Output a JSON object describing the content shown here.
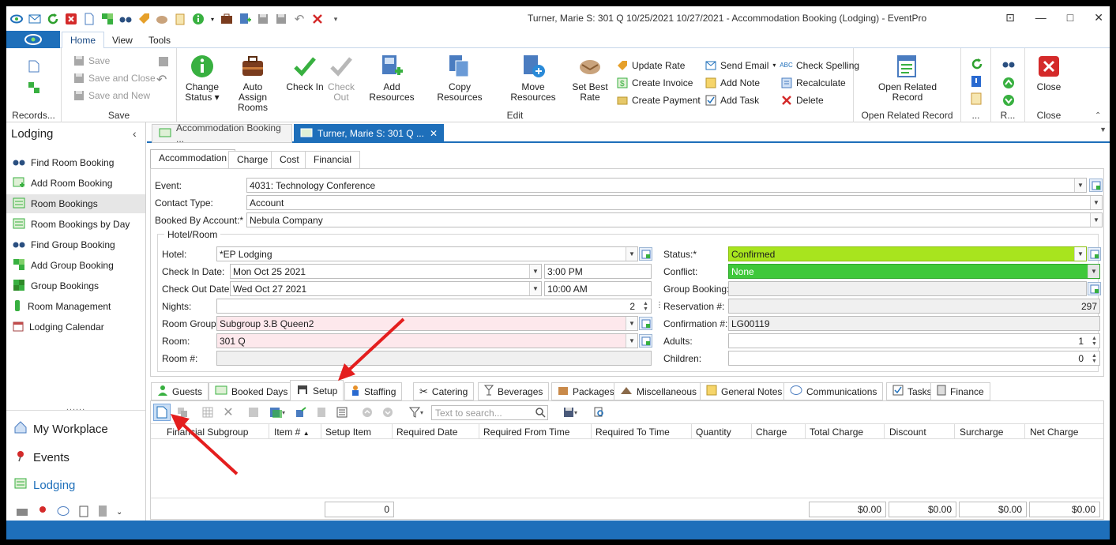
{
  "window": {
    "title": "Turner, Marie S: 301 Q 10/25/2021 10/27/2021 - Accommodation Booking (Lodging) - EventPro"
  },
  "ribbon_tabs": [
    "Home",
    "View",
    "Tools"
  ],
  "ribbon": {
    "records_label": "Records...",
    "save_group": {
      "label": "Save",
      "save": "Save",
      "save_close": "Save and Close",
      "save_new": "Save and New"
    },
    "edit_group": {
      "label": "Edit",
      "change_status": "Change Status",
      "auto_assign": "Auto Assign Rooms",
      "check_in": "Check In",
      "check_out": "Check Out",
      "add_resources": "Add Resources",
      "copy_resources": "Copy Resources",
      "move_resources": "Move Resources",
      "set_best_rate": "Set Best Rate",
      "update_rate": "Update Rate",
      "create_invoice": "Create Invoice",
      "create_payment": "Create Payment",
      "send_email": "Send Email",
      "add_note": "Add Note",
      "add_task": "Add Task",
      "check_spelling": "Check Spelling",
      "recalculate": "Recalculate",
      "delete": "Delete"
    },
    "open_related": {
      "label": "Open Related Record",
      "button": "Open Related Record"
    },
    "dots_label": "...",
    "r_label": "R...",
    "close_group": {
      "label": "Close",
      "button": "Close"
    }
  },
  "nav": {
    "header": "Lodging",
    "items": [
      {
        "label": "Find Room Booking",
        "icon": "binoculars-icon"
      },
      {
        "label": "Add Room Booking",
        "icon": "add-booking-icon"
      },
      {
        "label": "Room Bookings",
        "icon": "room-bookings-icon"
      },
      {
        "label": "Room Bookings by Day",
        "icon": "room-bookings-day-icon"
      },
      {
        "label": "Find Group Booking",
        "icon": "binoculars-icon"
      },
      {
        "label": "Add Group Booking",
        "icon": "add-group-icon"
      },
      {
        "label": "Group Bookings",
        "icon": "group-bookings-icon"
      },
      {
        "label": "Room Management",
        "icon": "room-management-icon"
      },
      {
        "label": "Lodging Calendar",
        "icon": "calendar-icon"
      }
    ],
    "grip": "......",
    "bottom": [
      {
        "label": "My Workplace",
        "icon": "home-icon"
      },
      {
        "label": "Events",
        "icon": "pin-icon"
      },
      {
        "label": "Lodging",
        "icon": "lodging-icon"
      }
    ]
  },
  "doc_tabs": [
    {
      "label": "Accommodation Booking ..."
    },
    {
      "label": "Turner, Marie S: 301 Q ..."
    }
  ],
  "form_tabs": [
    "Accommodation",
    "Charge",
    "Cost",
    "Financial"
  ],
  "form": {
    "event_label": "Event:",
    "event": "4031: Technology Conference",
    "contact_type_label": "Contact Type:",
    "contact_type": "Account",
    "booked_by_label": "Booked By Account:*",
    "booked_by": "Nebula Company",
    "hotel_room_legend": "Hotel/Room",
    "hotel_label": "Hotel:",
    "hotel": "*EP Lodging",
    "check_in_label": "Check In Date:",
    "check_in_date": "Mon Oct 25 2021",
    "check_in_time": "3:00 PM",
    "check_out_label": "Check Out Date:",
    "check_out_date": "Wed Oct 27 2021",
    "check_out_time": "10:00 AM",
    "nights_label": "Nights:",
    "nights": "2",
    "room_group_label": "Room Group:",
    "room_group": "Subgroup 3.B Queen2",
    "room_label": "Room:",
    "room": "301 Q",
    "room_num_label": "Room #:",
    "room_num": "",
    "status_label": "Status:*",
    "status": "Confirmed",
    "conflict_label": "Conflict:",
    "conflict": "None",
    "group_booking_label": "Group Booking:",
    "group_booking": "",
    "reservation_label": "Reservation #:",
    "reservation": "297",
    "confirmation_label": "Confirmation #:",
    "confirmation": "LG00119",
    "adults_label": "Adults:",
    "adults": "1",
    "children_label": "Children:",
    "children": "0"
  },
  "sub_tabs": [
    "Guests",
    "Booked Days",
    "Setup",
    "Staffing",
    "Catering",
    "Beverages",
    "Packages",
    "Miscellaneous",
    "General Notes",
    "Communications",
    "Tasks",
    "Finance"
  ],
  "grid": {
    "search_placeholder": "Text to search...",
    "columns": [
      "Financial Subgroup",
      "Item #",
      "Setup Item",
      "Required Date",
      "Required From Time",
      "Required To Time",
      "Quantity",
      "Charge",
      "Total Charge",
      "Discount",
      "Surcharge",
      "Net Charge"
    ],
    "totals": {
      "quantity": "0",
      "total_charge": "$0.00",
      "discount": "$0.00",
      "surcharge": "$0.00",
      "net_charge": "$0.00"
    }
  },
  "colors": {
    "accent": "#1e6fba",
    "status_green": "#a8e41e",
    "conflict_green": "#3fc83a",
    "required_pink": "#fde8ec",
    "annotation_red": "#e41e1e"
  }
}
